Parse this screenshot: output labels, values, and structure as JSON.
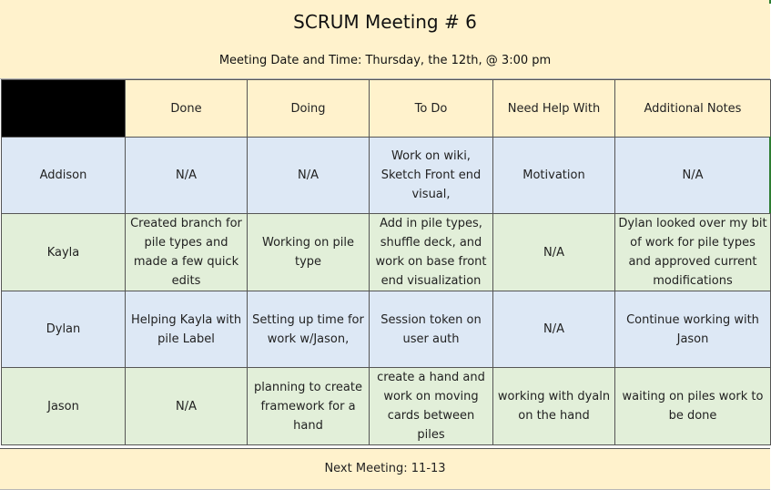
{
  "title": "SCRUM Meeting # 6",
  "meeting_info": "Meeting Date and Time: Thursday, the 12th, @ 3:00 pm",
  "columns": [
    "",
    "Done",
    "Doing",
    "To Do",
    "Need Help With",
    "Additional Notes"
  ],
  "rows": [
    {
      "name": "Addison",
      "done": "N/A",
      "doing": "N/A",
      "todo": "Work on wiki, Sketch Front end visual,",
      "help": "Motivation",
      "notes": "N/A"
    },
    {
      "name": "Kayla",
      "done": "Created branch for pile types and made a few quick edits",
      "doing": "Working on pile type",
      "todo": "Add in pile types, shuffle deck, and work on base front end visualization",
      "help": "N/A",
      "notes": "Dylan looked over my bit of work for pile types and approved current modifications"
    },
    {
      "name": "Dylan",
      "done": "Helping Kayla with pile Label",
      "doing": "Setting up time for work w/Jason,",
      "todo": "Session token on user auth",
      "help": "N/A",
      "notes": "Continue working with Jason"
    },
    {
      "name": "Jason",
      "done": "N/A",
      "doing": "planning to create framework for a hand",
      "todo": "create a hand and work on moving cards between piles",
      "help": "working with dyaln on the hand",
      "notes": "waiting on piles work to be done"
    }
  ],
  "footer": "Next Meeting: 11-13",
  "colors": {
    "header_bg": "#fff2cc",
    "row_blue": "#dde8f5",
    "row_green": "#e2efd9",
    "corner": "#000000"
  }
}
